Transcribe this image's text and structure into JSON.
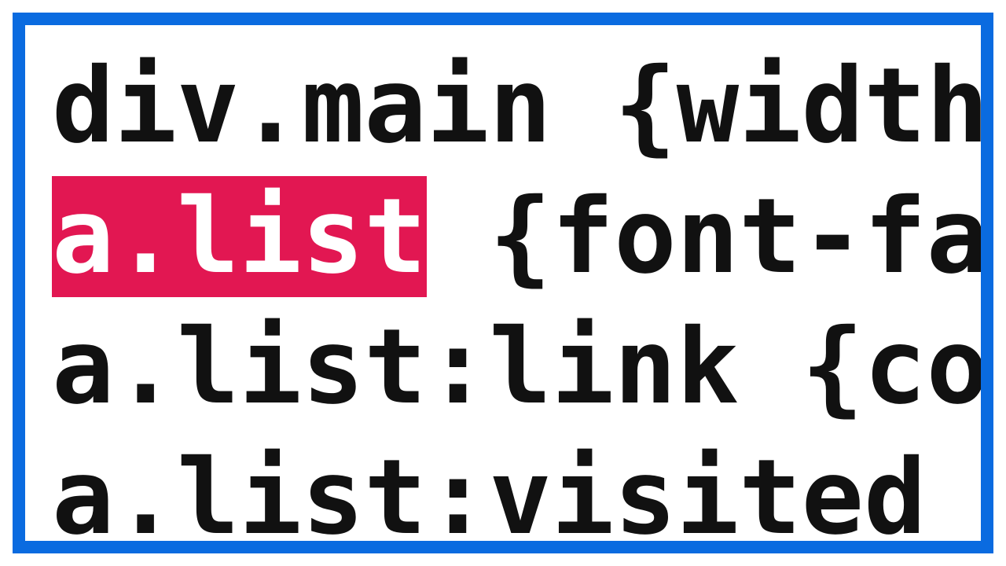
{
  "colors": {
    "border": "#0a6be0",
    "highlight_bg": "#e21752",
    "highlight_fg": "#ffffff",
    "text": "#111111"
  },
  "code": {
    "lines": [
      {
        "plain": "div.main {width"
      },
      {
        "highlight": "a.list",
        "rest": " {font-fa"
      },
      {
        "plain": "a.list:link {co"
      },
      {
        "plain": "a.list:visited"
      }
    ]
  }
}
